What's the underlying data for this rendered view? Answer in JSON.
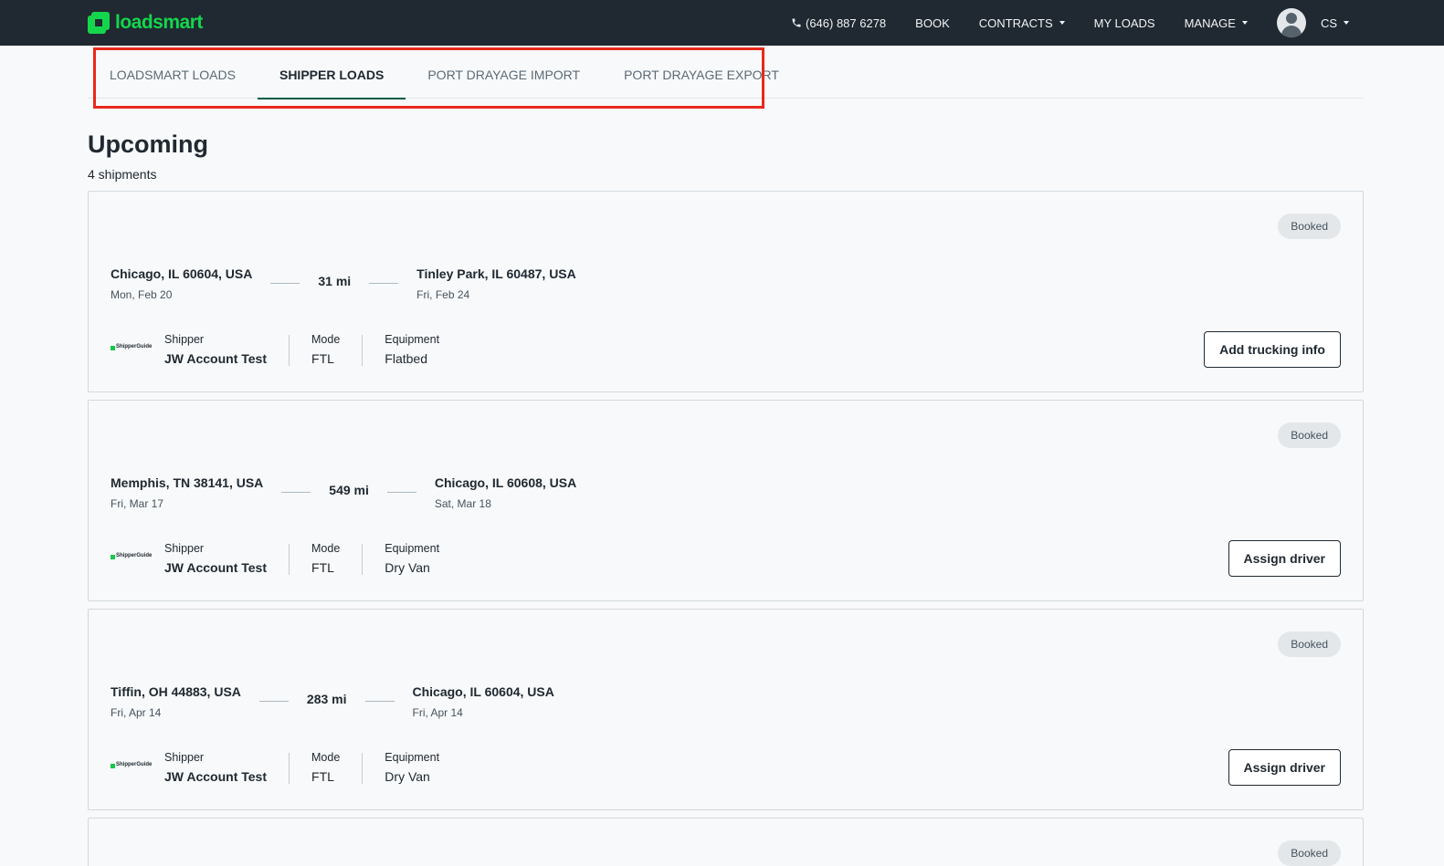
{
  "brand": {
    "name": "loadsmart",
    "color": "#14d64d"
  },
  "nav": {
    "phone": "(646) 887 6278",
    "book": "BOOK",
    "contracts": "CONTRACTS",
    "my_loads": "MY LOADS",
    "manage": "MANAGE",
    "user_initials": "CS"
  },
  "tabs": [
    {
      "label": "LOADSMART LOADS",
      "active": false
    },
    {
      "label": "SHIPPER LOADS",
      "active": true
    },
    {
      "label": "PORT DRAYAGE IMPORT",
      "active": false
    },
    {
      "label": "PORT DRAYAGE EXPORT",
      "active": false
    }
  ],
  "section": {
    "title": "Upcoming",
    "count": "4 shipments"
  },
  "labels": {
    "shipper": "Shipper",
    "mode": "Mode",
    "equipment": "Equipment",
    "shipper_logo": "ShipperGuide"
  },
  "shipments": [
    {
      "status": "Booked",
      "origin": {
        "city": "Chicago, IL 60604, USA",
        "date": "Mon, Feb 20"
      },
      "distance": "31 mi",
      "destination": {
        "city": "Tinley Park, IL 60487, USA",
        "date": "Fri, Feb 24"
      },
      "shipper": "JW Account Test",
      "mode": "FTL",
      "equipment": "Flatbed",
      "action": "Add trucking info"
    },
    {
      "status": "Booked",
      "origin": {
        "city": "Memphis, TN 38141, USA",
        "date": "Fri, Mar 17"
      },
      "distance": "549 mi",
      "destination": {
        "city": "Chicago, IL 60608, USA",
        "date": "Sat, Mar 18"
      },
      "shipper": "JW Account Test",
      "mode": "FTL",
      "equipment": "Dry Van",
      "action": "Assign driver"
    },
    {
      "status": "Booked",
      "origin": {
        "city": "Tiffin, OH 44883, USA",
        "date": "Fri, Apr 14"
      },
      "distance": "283 mi",
      "destination": {
        "city": "Chicago, IL 60604, USA",
        "date": "Fri, Apr 14"
      },
      "shipper": "JW Account Test",
      "mode": "FTL",
      "equipment": "Dry Van",
      "action": "Assign driver"
    },
    {
      "status": "Booked"
    }
  ]
}
